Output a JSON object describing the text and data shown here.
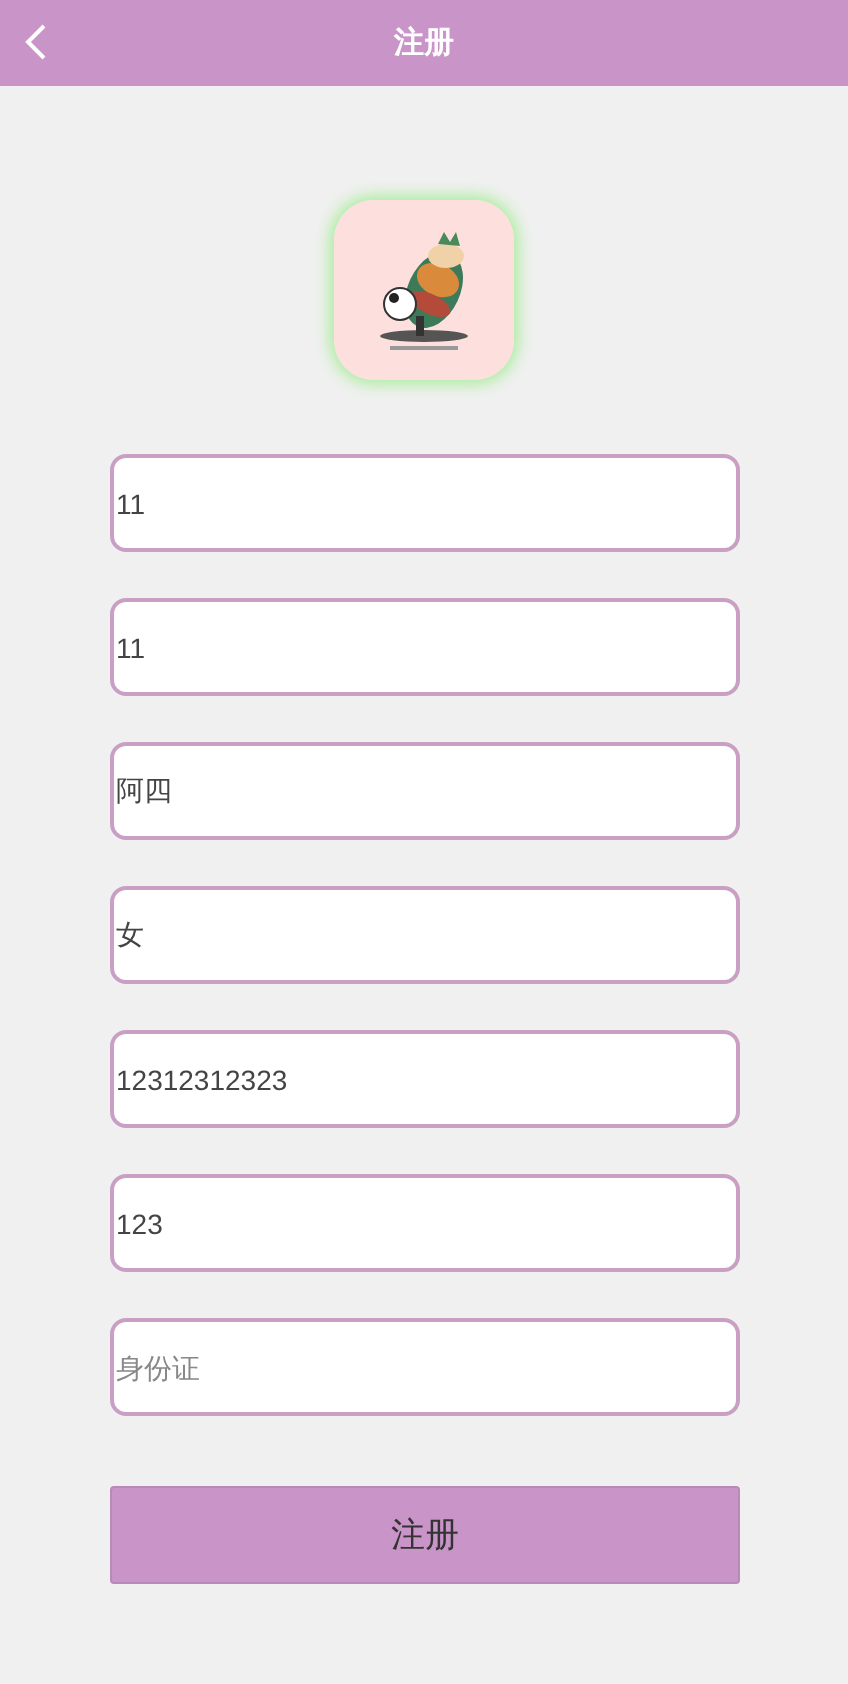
{
  "header": {
    "title": "注册"
  },
  "fields": [
    {
      "value": "11"
    },
    {
      "value": "11"
    },
    {
      "value": "阿四"
    },
    {
      "value": "女"
    },
    {
      "value": "12312312323"
    },
    {
      "value": "123"
    },
    {
      "placeholder": "身份证"
    }
  ],
  "submit": {
    "label": "注册"
  }
}
